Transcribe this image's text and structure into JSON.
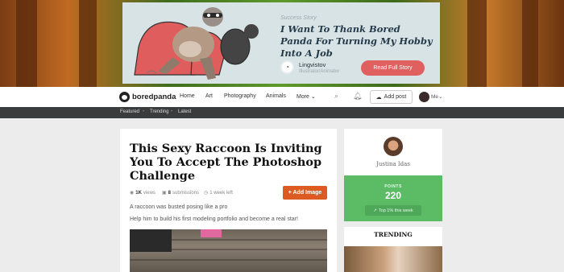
{
  "ad": {
    "kicker": "Success Story",
    "title": "I Want To Thank Bored Panda For Turning My Hobby Into A Job",
    "author": "Lingvistov",
    "author_sub": "Illustrator/Animator",
    "cta": "Read Full Story"
  },
  "nav": {
    "logo": "boredpanda",
    "links": [
      "Home",
      "Art",
      "Photography",
      "Animals",
      "More"
    ],
    "add_post": "Add post",
    "me": "Me"
  },
  "subnav": [
    "Featured",
    "Trending",
    "Latest"
  ],
  "post": {
    "title": "This Sexy Raccoon Is Inviting You To Accept The Photoshop Challenge",
    "views_count": "1K",
    "views_label": "views",
    "submissions_count": "8",
    "submissions_label": "submissions",
    "time_left": "1 week left",
    "add_image": "+ Add Image",
    "desc1": "A raccoon was busted posing like a pro",
    "desc2": "Help him to build his first modeling portfolio and become a real star!"
  },
  "sidebar": {
    "name": "Justina Idas",
    "points_label": "POINTS",
    "points_value": "220",
    "top_text": "Top 1% this week",
    "trending_title": "TRENDING"
  },
  "colors": {
    "accent": "#dc5b23",
    "points_green": "#5cbc66",
    "ad_button": "#e06060",
    "subnav_bg": "#3a3b3c"
  }
}
